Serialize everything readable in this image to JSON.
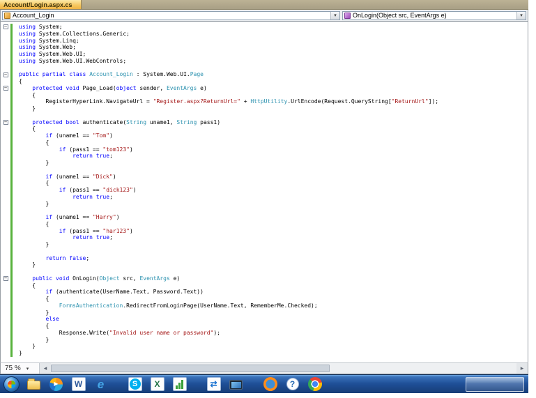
{
  "window": {
    "tab_title": "Account/Login.aspx.cs"
  },
  "navbar": {
    "class_dropdown": "Account_Login",
    "method_dropdown": "OnLogin(Object src, EventArgs e)"
  },
  "icons": {
    "caret_down": "▾",
    "scroll_left": "◂",
    "scroll_right": "▸",
    "fold_collapse": "−"
  },
  "statusbar": {
    "zoom": "75 %"
  },
  "colors": {
    "active_tab": "#f6c65e",
    "tab_strip_bg": "#b0a78a",
    "keyword": "#0000ff",
    "type": "#2b91af",
    "string": "#a31515",
    "change_bar": "#57b23c",
    "taskbar_blue": "#1f4f97"
  },
  "taskbar": {
    "items": [
      {
        "name": "start",
        "glyph": ""
      },
      {
        "name": "windows-explorer",
        "glyph": ""
      },
      {
        "name": "media-player",
        "glyph": "▶"
      },
      {
        "name": "word-document",
        "glyph": "W"
      },
      {
        "name": "internet-explorer",
        "glyph": "e"
      },
      {
        "name": "skype",
        "glyph": "S"
      },
      {
        "name": "excel",
        "glyph": "X"
      },
      {
        "name": "chart-tool",
        "glyph": ""
      },
      {
        "name": "sync-tool",
        "glyph": "⇄"
      },
      {
        "name": "display-tool",
        "glyph": ""
      },
      {
        "name": "web-browser",
        "glyph": ""
      },
      {
        "name": "help",
        "glyph": "?"
      },
      {
        "name": "chrome",
        "glyph": ""
      }
    ]
  },
  "editor": {
    "lines": [
      {
        "fold": true,
        "tokens": [
          [
            "k",
            "using"
          ],
          [
            "n",
            " System;"
          ]
        ]
      },
      {
        "tokens": [
          [
            "k",
            "using"
          ],
          [
            "n",
            " System.Collections.Generic;"
          ]
        ]
      },
      {
        "tokens": [
          [
            "k",
            "using"
          ],
          [
            "n",
            " System.Linq;"
          ]
        ]
      },
      {
        "tokens": [
          [
            "k",
            "using"
          ],
          [
            "n",
            " System.Web;"
          ]
        ]
      },
      {
        "tokens": [
          [
            "k",
            "using"
          ],
          [
            "n",
            " System.Web.UI;"
          ]
        ]
      },
      {
        "tokens": [
          [
            "k",
            "using"
          ],
          [
            "n",
            " System.Web.UI.WebControls;"
          ]
        ]
      },
      {
        "tokens": []
      },
      {
        "fold": true,
        "tokens": [
          [
            "k",
            "public"
          ],
          [
            "n",
            " "
          ],
          [
            "k",
            "partial"
          ],
          [
            "n",
            " "
          ],
          [
            "k",
            "class"
          ],
          [
            "n",
            " "
          ],
          [
            "c",
            "Account_Login"
          ],
          [
            "n",
            " : System.Web.UI."
          ],
          [
            "c",
            "Page"
          ]
        ]
      },
      {
        "tokens": [
          [
            "n",
            "{"
          ]
        ]
      },
      {
        "fold": true,
        "tokens": [
          [
            "n",
            "    "
          ],
          [
            "k",
            "protected"
          ],
          [
            "n",
            " "
          ],
          [
            "k",
            "void"
          ],
          [
            "n",
            " Page_Load("
          ],
          [
            "k",
            "object"
          ],
          [
            "n",
            " sender, "
          ],
          [
            "c",
            "EventArgs"
          ],
          [
            "n",
            " e)"
          ]
        ]
      },
      {
        "tokens": [
          [
            "n",
            "    {"
          ]
        ]
      },
      {
        "tokens": [
          [
            "n",
            "        RegisterHyperLink.NavigateUrl = "
          ],
          [
            "s",
            "\"Register.aspx?ReturnUrl=\""
          ],
          [
            "n",
            " + "
          ],
          [
            "c",
            "HttpUtility"
          ],
          [
            "n",
            ".UrlEncode(Request.QueryString["
          ],
          [
            "s",
            "\"ReturnUrl\""
          ],
          [
            "n",
            "]);"
          ]
        ]
      },
      {
        "tokens": [
          [
            "n",
            "    }"
          ]
        ]
      },
      {
        "tokens": []
      },
      {
        "fold": true,
        "tokens": [
          [
            "n",
            "    "
          ],
          [
            "k",
            "protected"
          ],
          [
            "n",
            " "
          ],
          [
            "k",
            "bool"
          ],
          [
            "n",
            " authenticate("
          ],
          [
            "c",
            "String"
          ],
          [
            "n",
            " uname1, "
          ],
          [
            "c",
            "String"
          ],
          [
            "n",
            " pass1)"
          ]
        ]
      },
      {
        "tokens": [
          [
            "n",
            "    {"
          ]
        ]
      },
      {
        "tokens": [
          [
            "n",
            "        "
          ],
          [
            "k",
            "if"
          ],
          [
            "n",
            " (uname1 == "
          ],
          [
            "s",
            "\"Tom\""
          ],
          [
            "n",
            ")"
          ]
        ]
      },
      {
        "tokens": [
          [
            "n",
            "        {"
          ]
        ]
      },
      {
        "tokens": [
          [
            "n",
            "            "
          ],
          [
            "k",
            "if"
          ],
          [
            "n",
            " (pass1 == "
          ],
          [
            "s",
            "\"tom123\""
          ],
          [
            "n",
            ")"
          ]
        ]
      },
      {
        "tokens": [
          [
            "n",
            "                "
          ],
          [
            "k",
            "return"
          ],
          [
            "n",
            " "
          ],
          [
            "k",
            "true"
          ],
          [
            "n",
            ";"
          ]
        ]
      },
      {
        "tokens": [
          [
            "n",
            "        }"
          ]
        ]
      },
      {
        "tokens": []
      },
      {
        "tokens": [
          [
            "n",
            "        "
          ],
          [
            "k",
            "if"
          ],
          [
            "n",
            " (uname1 == "
          ],
          [
            "s",
            "\"Dick\""
          ],
          [
            "n",
            ")"
          ]
        ]
      },
      {
        "tokens": [
          [
            "n",
            "        {"
          ]
        ]
      },
      {
        "tokens": [
          [
            "n",
            "            "
          ],
          [
            "k",
            "if"
          ],
          [
            "n",
            " (pass1 == "
          ],
          [
            "s",
            "\"dick123\""
          ],
          [
            "n",
            ")"
          ]
        ]
      },
      {
        "tokens": [
          [
            "n",
            "                "
          ],
          [
            "k",
            "return"
          ],
          [
            "n",
            " "
          ],
          [
            "k",
            "true"
          ],
          [
            "n",
            ";"
          ]
        ]
      },
      {
        "tokens": [
          [
            "n",
            "        }"
          ]
        ]
      },
      {
        "tokens": []
      },
      {
        "tokens": [
          [
            "n",
            "        "
          ],
          [
            "k",
            "if"
          ],
          [
            "n",
            " (uname1 == "
          ],
          [
            "s",
            "\"Harry\""
          ],
          [
            "n",
            ")"
          ]
        ]
      },
      {
        "tokens": [
          [
            "n",
            "        {"
          ]
        ]
      },
      {
        "tokens": [
          [
            "n",
            "            "
          ],
          [
            "k",
            "if"
          ],
          [
            "n",
            " (pass1 == "
          ],
          [
            "s",
            "\"har123\""
          ],
          [
            "n",
            ")"
          ]
        ]
      },
      {
        "tokens": [
          [
            "n",
            "                "
          ],
          [
            "k",
            "return"
          ],
          [
            "n",
            " "
          ],
          [
            "k",
            "true"
          ],
          [
            "n",
            ";"
          ]
        ]
      },
      {
        "tokens": [
          [
            "n",
            "        }"
          ]
        ]
      },
      {
        "tokens": []
      },
      {
        "tokens": [
          [
            "n",
            "        "
          ],
          [
            "k",
            "return"
          ],
          [
            "n",
            " "
          ],
          [
            "k",
            "false"
          ],
          [
            "n",
            ";"
          ]
        ]
      },
      {
        "tokens": [
          [
            "n",
            "    }"
          ]
        ]
      },
      {
        "tokens": []
      },
      {
        "fold": true,
        "tokens": [
          [
            "n",
            "    "
          ],
          [
            "k",
            "public"
          ],
          [
            "n",
            " "
          ],
          [
            "k",
            "void"
          ],
          [
            "n",
            " OnLogin("
          ],
          [
            "c",
            "Object"
          ],
          [
            "n",
            " src, "
          ],
          [
            "c",
            "EventArgs"
          ],
          [
            "n",
            " e)"
          ]
        ]
      },
      {
        "tokens": [
          [
            "n",
            "    {"
          ]
        ]
      },
      {
        "tokens": [
          [
            "n",
            "        "
          ],
          [
            "k",
            "if"
          ],
          [
            "n",
            " (authenticate(UserName.Text, Password.Text))"
          ]
        ]
      },
      {
        "tokens": [
          [
            "n",
            "        {"
          ]
        ]
      },
      {
        "tokens": [
          [
            "n",
            "            "
          ],
          [
            "c",
            "FormsAuthentication"
          ],
          [
            "n",
            ".RedirectFromLoginPage(UserName.Text, RememberMe.Checked);"
          ]
        ]
      },
      {
        "tokens": [
          [
            "n",
            "        }"
          ]
        ]
      },
      {
        "tokens": [
          [
            "n",
            "        "
          ],
          [
            "k",
            "else"
          ]
        ]
      },
      {
        "tokens": [
          [
            "n",
            "        {"
          ]
        ]
      },
      {
        "tokens": [
          [
            "n",
            "            Response.Write("
          ],
          [
            "s",
            "\"Invalid user name or password\""
          ],
          [
            "n",
            ");"
          ]
        ]
      },
      {
        "tokens": [
          [
            "n",
            "        }"
          ]
        ]
      },
      {
        "tokens": [
          [
            "n",
            "    }"
          ]
        ]
      },
      {
        "tokens": [
          [
            "n",
            "}"
          ]
        ]
      }
    ]
  }
}
